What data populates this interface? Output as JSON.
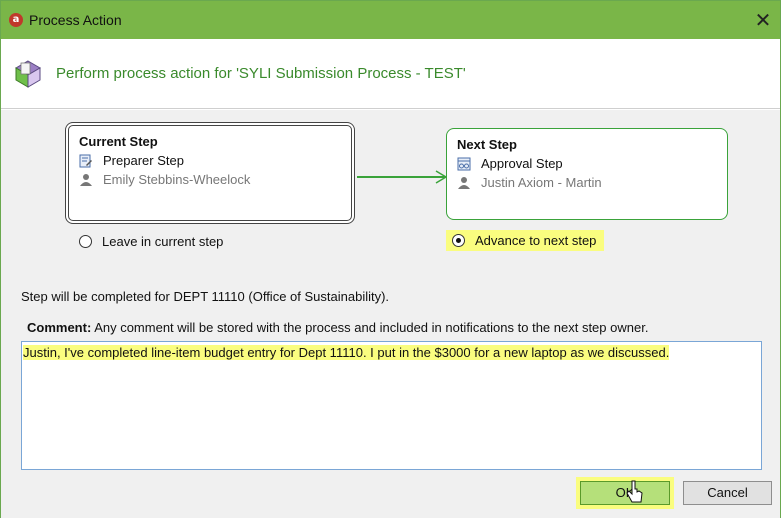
{
  "window": {
    "title": "Process Action",
    "app_icon_letter": "a"
  },
  "header": {
    "text": "Perform process action for 'SYLI Submission Process - TEST'"
  },
  "current_step": {
    "title": "Current Step",
    "step_name": "Preparer Step",
    "person": "Emily Stebbins-Wheelock"
  },
  "next_step": {
    "title": "Next Step",
    "step_name": "Approval Step",
    "person": "Justin Axiom - Martin"
  },
  "options": {
    "leave_label": "Leave in current step",
    "advance_label": "Advance to next step",
    "selected": "advance"
  },
  "note": "Step will be completed for DEPT 11110 (Office of Sustainability).",
  "comment": {
    "label": "Comment:",
    "hint": "Any comment will be stored with the process and included in notifications to the next step owner.",
    "value": "Justin, I've completed line-item budget entry for Dept 11110. I put in the $3000 for a new laptop as we discussed."
  },
  "buttons": {
    "ok": "OK",
    "cancel": "Cancel"
  },
  "colors": {
    "title_bar": "#7ab648",
    "accent_green": "#3a8a2c",
    "highlight_yellow": "#fafd7f"
  }
}
